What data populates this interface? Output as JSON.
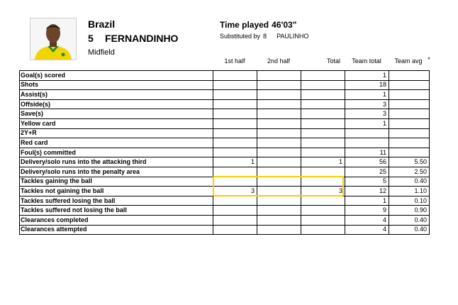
{
  "header": {
    "team": "Brazil",
    "player_number": "5",
    "player_name": "FERNANDINHO",
    "position": "Midfield",
    "time_played_label": "Time played",
    "time_played_value": "46'03\"",
    "substituted_label": "Substituted by",
    "substituted_number": "8",
    "substituted_name": "PAULINHO"
  },
  "columns": [
    "1st half",
    "2nd half",
    "Total",
    "Team total",
    "Team avg",
    "*"
  ],
  "rows": [
    {
      "label": "Goal(s) scored",
      "first": "",
      "second": "",
      "total": "",
      "team_total": "1",
      "team_avg": ""
    },
    {
      "label": "Shots",
      "first": "",
      "second": "",
      "total": "",
      "team_total": "18",
      "team_avg": ""
    },
    {
      "label": "Assist(s)",
      "first": "",
      "second": "",
      "total": "",
      "team_total": "1",
      "team_avg": ""
    },
    {
      "label": "Offside(s)",
      "first": "",
      "second": "",
      "total": "",
      "team_total": "3",
      "team_avg": ""
    },
    {
      "label": "Save(s)",
      "first": "",
      "second": "",
      "total": "",
      "team_total": "3",
      "team_avg": ""
    },
    {
      "label": "Yellow card",
      "first": "",
      "second": "",
      "total": "",
      "team_total": "1",
      "team_avg": ""
    },
    {
      "label": "2Y+R",
      "first": "",
      "second": "",
      "total": "",
      "team_total": "",
      "team_avg": ""
    },
    {
      "label": "Red card",
      "first": "",
      "second": "",
      "total": "",
      "team_total": "",
      "team_avg": ""
    },
    {
      "label": "Foul(s) committed",
      "first": "",
      "second": "",
      "total": "",
      "team_total": "11",
      "team_avg": ""
    },
    {
      "label": "Delivery/solo runs into the attacking third",
      "first": "1",
      "second": "",
      "total": "1",
      "team_total": "56",
      "team_avg": "5.50"
    },
    {
      "label": "Delivery/solo runs into the penalty area",
      "first": "",
      "second": "",
      "total": "",
      "team_total": "25",
      "team_avg": "2.50"
    },
    {
      "label": "Tackles gaining the ball",
      "first": "",
      "second": "",
      "total": "",
      "team_total": "5",
      "team_avg": "0.40"
    },
    {
      "label": "Tackles not gaining the ball",
      "first": "3",
      "second": "",
      "total": "3",
      "team_total": "12",
      "team_avg": "1.10"
    },
    {
      "label": "Tackles suffered losing the ball",
      "first": "",
      "second": "",
      "total": "",
      "team_total": "1",
      "team_avg": "0.10"
    },
    {
      "label": "Tackles suffered not losing the ball",
      "first": "",
      "second": "",
      "total": "",
      "team_total": "9",
      "team_avg": "0.90"
    },
    {
      "label": "Clearances completed",
      "first": "",
      "second": "",
      "total": "",
      "team_total": "4",
      "team_avg": "0.40"
    },
    {
      "label": "Clearances attempted",
      "first": "",
      "second": "",
      "total": "",
      "team_total": "4",
      "team_avg": "0.40"
    }
  ],
  "colors": {
    "highlight_border": "#f5d000",
    "jersey_yellow": "#f2d400",
    "jersey_green": "#1f8a3b"
  }
}
